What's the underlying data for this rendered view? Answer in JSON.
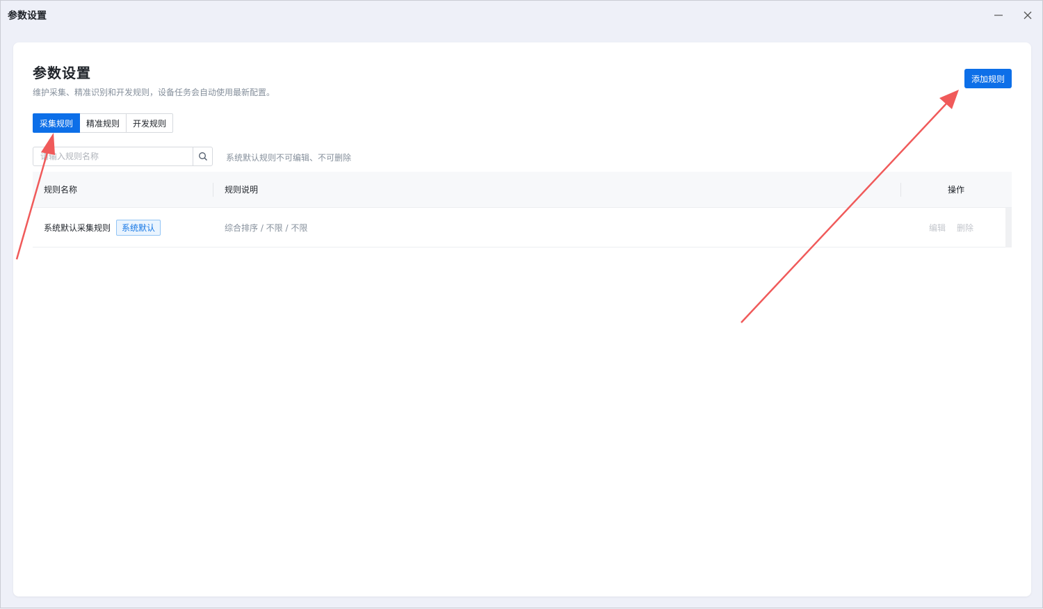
{
  "window": {
    "title": "参数设置"
  },
  "page": {
    "title": "参数设置",
    "subtitle": "维护采集、精准识别和开发规则，设备任务会自动使用最新配置。",
    "add_button": "添加规则"
  },
  "tabs": [
    {
      "label": "采集规则",
      "active": true
    },
    {
      "label": "精准规则",
      "active": false
    },
    {
      "label": "开发规则",
      "active": false
    }
  ],
  "search": {
    "placeholder": "请输入规则名称",
    "value": "",
    "hint": "系统默认规则不可编辑、不可删除"
  },
  "table": {
    "columns": [
      "规则名称",
      "规则说明",
      "操作"
    ],
    "rows": [
      {
        "name": "系统默认采集规则",
        "badge": "系统默认",
        "description": "综合排序 / 不限 / 不限",
        "actions": [
          "编辑",
          "删除"
        ]
      }
    ]
  },
  "colors": {
    "accent": "#0d6fe8",
    "annotation_arrow": "#f05a5a",
    "badge_text": "#1677e5"
  }
}
